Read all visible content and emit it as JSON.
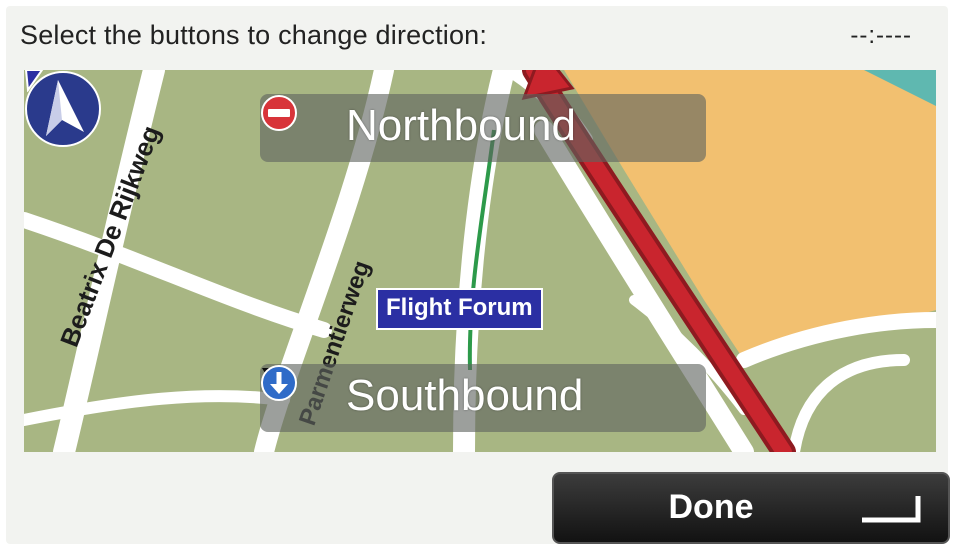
{
  "header": {
    "instruction": "Select the buttons to change direction:",
    "time": "--:----"
  },
  "map": {
    "streets": [
      "Beatrix De Rijkweg",
      "Parmentierweg"
    ],
    "poi_label": "Flight Forum",
    "colors": {
      "land": "#a8b683",
      "area": "#f2c070",
      "water": "#5fb8b0",
      "road": "#ffffff",
      "route": "#c9252e",
      "path": "#2d9a4a"
    }
  },
  "directions": {
    "north_label": "Northbound",
    "north_icon": "no-entry-icon",
    "south_label": "Southbound",
    "south_icon": "down-arrow-circle-icon"
  },
  "footer": {
    "done_label": "Done",
    "done_icon": "enter-return-icon"
  }
}
